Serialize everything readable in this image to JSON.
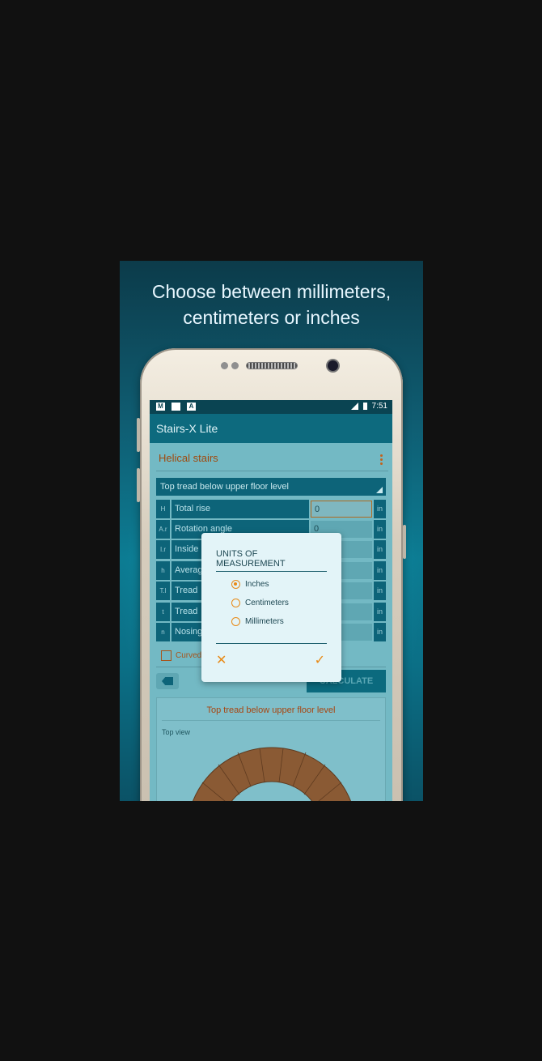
{
  "headline": {
    "line1": "Choose between millimeters,",
    "line2": "centimeters or inches"
  },
  "statusbar": {
    "icons": [
      "gmail-icon",
      "sd-card-icon",
      "a-icon"
    ],
    "time": "7:51"
  },
  "app": {
    "title": "Stairs-X Lite",
    "section": "Helical stairs",
    "dropdown": "Top tread below upper floor level",
    "rows": [
      {
        "sym": "H",
        "label": "Total rise",
        "value": "0",
        "unit": "in"
      },
      {
        "sym": "A.r",
        "label": "Rotation angle",
        "value": "0",
        "unit": "in"
      },
      {
        "sym": "I.r",
        "label": "Inside",
        "value": "",
        "unit": "in"
      },
      {
        "sym": "h",
        "label": "Averag",
        "value": "",
        "unit": "in"
      },
      {
        "sym": "T.l",
        "label": "Tread",
        "value": "",
        "unit": "in"
      },
      {
        "sym": "t",
        "label": "Tread",
        "value": "",
        "unit": "in"
      },
      {
        "sym": "n",
        "label": "Nosing",
        "value": "",
        "unit": "in"
      }
    ],
    "curved_label": "Curved",
    "calculate_label": "CALCULATE",
    "panel_title": "Top tread below upper floor level",
    "panel_view": "Top view"
  },
  "dialog": {
    "title": "UNITS OF MEASUREMENT",
    "options": [
      "Inches",
      "Centimeters",
      "Millimeters"
    ],
    "selected": "Inches",
    "cancel_icon": "close-icon",
    "ok_icon": "check-icon"
  },
  "colors": {
    "accent": "#e88a17",
    "primary": "#0d6a7e",
    "tread": "#8a5a34"
  }
}
